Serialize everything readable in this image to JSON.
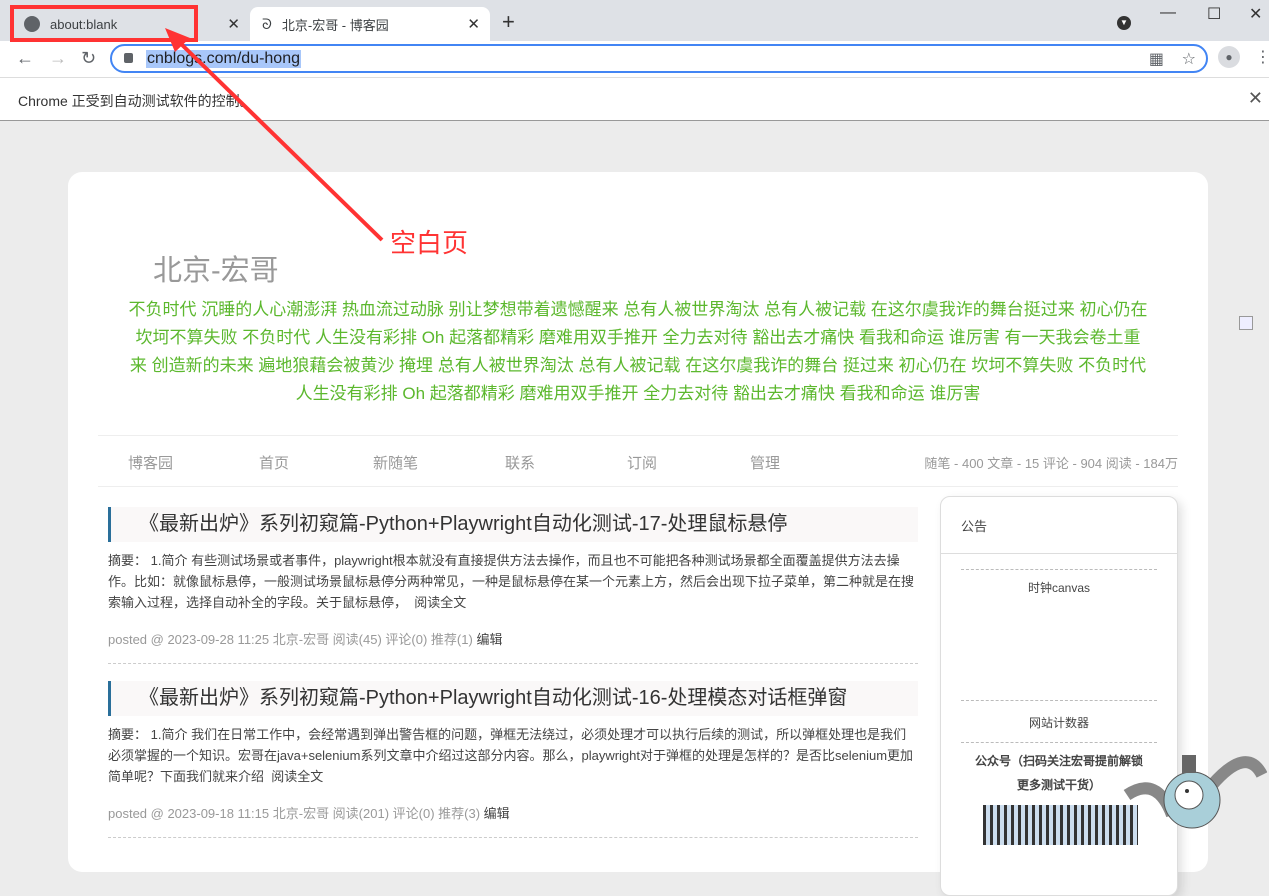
{
  "browser": {
    "tabs": [
      {
        "label": "about:blank",
        "icon": "globe-icon"
      },
      {
        "label": "北京-宏哥 - 博客园",
        "icon": "cnblogs-icon"
      }
    ],
    "url": "cnblogs.com/du-hong",
    "infobar": "Chrome 正受到自动测试软件的控制。"
  },
  "annotation": {
    "label": "空白页",
    "color": "#ff3333"
  },
  "blog": {
    "title": "北京-宏哥",
    "motto": "不负时代 沉睡的人心潮澎湃 热血流过动脉 别让梦想带着遗憾醒来 总有人被世界淘汰 总有人被记载 在这尔虞我诈的舞台挺过来 初心仍在 坎坷不算失败 不负时代 人生没有彩排 Oh 起落都精彩 磨难用双手推开 全力去对待 豁出去才痛快 看我和命运 谁厉害 有一天我会卷土重来 创造新的未来 遍地狼藉会被黄沙 掩埋 总有人被世界淘汰 总有人被记载 在这尔虞我诈的舞台 挺过来 初心仍在 坎坷不算失败 不负时代 人生没有彩排 Oh 起落都精彩 磨难用双手推开 全力去对待 豁出去才痛快 看我和命运 谁厉害",
    "nav": [
      "博客园",
      "首页",
      "新随笔",
      "联系",
      "订阅",
      "管理"
    ],
    "stats": "随笔 - 400  文章 - 15  评论 - 904  阅读 - 184万",
    "posts": [
      {
        "title": "《最新出炉》系列初窥篇-Python+Playwright自动化测试-17-处理鼠标悬停",
        "summary": "摘要： 1.简介 有些测试场景或者事件，playwright根本就没有直接提供方法去操作，而且也不可能把各种测试场景都全面覆盖提供方法去操作。比如：就像鼠标悬停，一般测试场景鼠标悬停分两种常见，一种是鼠标悬停在某一个元素上方，然后会出现下拉子菜单，第二种就是在搜索输入过程，选择自动补全的字段。关于鼠标悬停，",
        "read_more": "阅读全文",
        "meta": "posted @ 2023-09-28 11:25 北京-宏哥 阅读(45) 评论(0) 推荐(1)",
        "edit": "编辑"
      },
      {
        "title": "《最新出炉》系列初窥篇-Python+Playwright自动化测试-16-处理模态对话框弹窗",
        "summary": "摘要： 1.简介 我们在日常工作中，会经常遇到弹出警告框的问题，弹框无法绕过，必须处理才可以执行后续的测试，所以弹框处理也是我们必须掌握的一个知识。宏哥在java+selenium系列文章中介绍过这部分内容。那么，playwright对于弹框的处理是怎样的？是否比selenium更加简单呢？下面我们就来介绍",
        "read_more": "阅读全文",
        "meta": "posted @ 2023-09-18 11:15 北京-宏哥 阅读(201) 评论(0) 推荐(3)",
        "edit": "编辑"
      }
    ],
    "sidebar": {
      "heading": "公告",
      "clock": "时钟canvas",
      "counter": "网站计数器",
      "wechat": "公众号（扫码关注宏哥提前解锁更多测试干货）"
    }
  }
}
